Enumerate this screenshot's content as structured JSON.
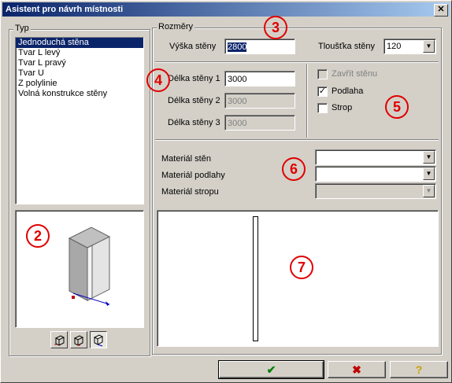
{
  "window": {
    "title": "Asistent pro návrh místnosti",
    "close_glyph": "✕"
  },
  "typ_group": {
    "label": "Typ",
    "items": [
      "Jednoduchá stěna",
      "Tvar L levý",
      "Tvar L pravý",
      "Tvar U",
      "Z polylinie",
      "Volná konstrukce stěny"
    ],
    "selected_index": 0
  },
  "rozmery_group": {
    "label": "Rozměry",
    "vyska_label": "Výška stěny",
    "vyska_value": "2800",
    "tloustka_label": "Tloušťka stěny",
    "tloustka_value": "120"
  },
  "delky": {
    "delka1_label": "Délka stěny 1",
    "delka1_value": "3000",
    "delka2_label": "Délka stěny 2",
    "delka2_value": "3000",
    "delka3_label": "Délka stěny 3",
    "delka3_value": "3000"
  },
  "options": {
    "zavrit_label": "Zavřít stěnu",
    "zavrit_checked": false,
    "zavrit_enabled": false,
    "podlaha_label": "Podlaha",
    "podlaha_checked": true,
    "strop_label": "Strop",
    "strop_checked": false
  },
  "materials": {
    "sten_label": "Materiál stěn",
    "sten_value": "",
    "podlahy_label": "Materiál podlahy",
    "podlahy_value": "",
    "stropu_label": "Materiál stropu",
    "stropu_value": ""
  },
  "badges": [
    "2",
    "3",
    "4",
    "5",
    "6",
    "7"
  ],
  "buttons": {
    "ok_glyph": "✔",
    "cancel_glyph": "✖",
    "help_glyph": "?"
  },
  "colors": {
    "ok": "#008000",
    "cancel": "#c00000",
    "help": "#c8a000",
    "badge": "#e00000"
  }
}
